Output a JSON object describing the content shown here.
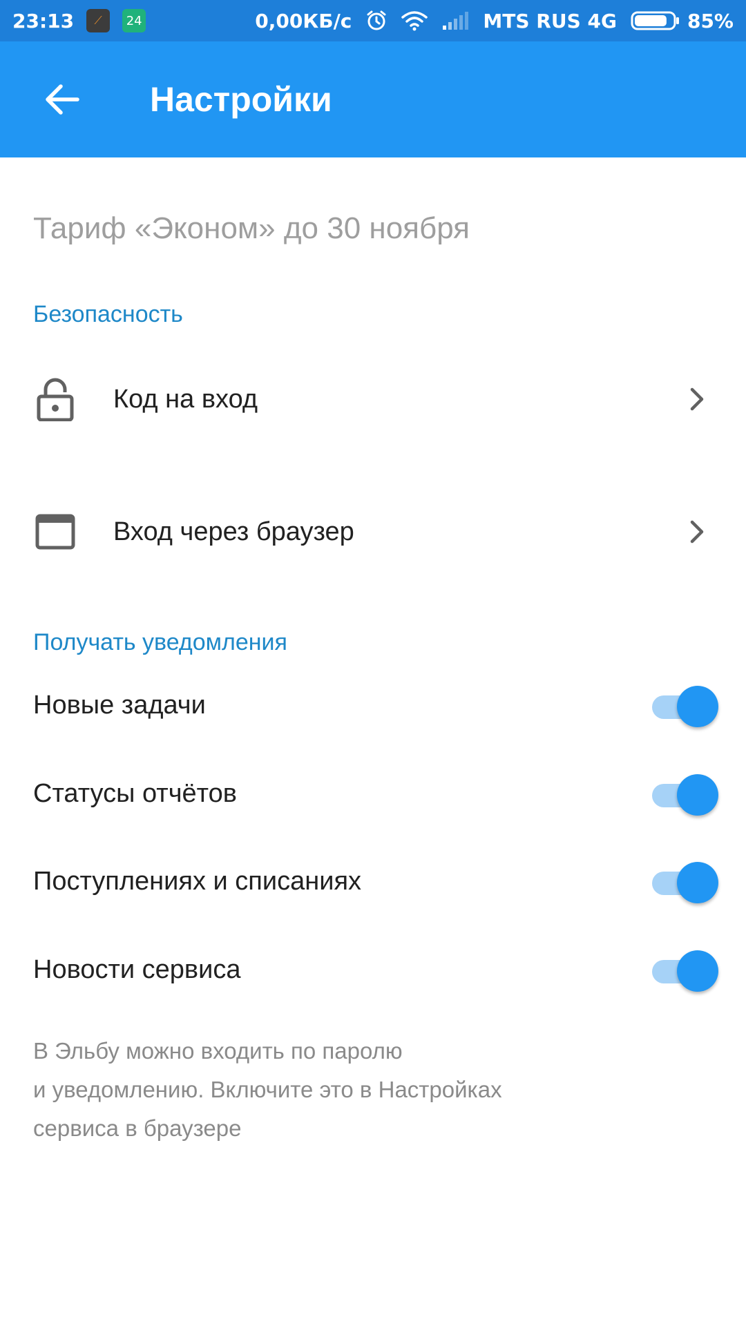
{
  "status_bar": {
    "time": "23:13",
    "notification_badge": "24",
    "network_speed": "0,00КБ/с",
    "carrier": "MTS RUS 4G",
    "battery_percent": "85%",
    "battery_level": 0.85,
    "icons": [
      "alarm-icon",
      "wifi-icon",
      "signal-icon",
      "battery-icon"
    ]
  },
  "app_bar": {
    "title": "Настройки",
    "back_icon": "arrow-left-icon",
    "color": "#2196f3"
  },
  "tariff_text": "Тариф «Эконом» до 30 ноября",
  "security": {
    "header": "Безопасность",
    "items": [
      {
        "label": "Код на вход",
        "icon": "lock-icon"
      },
      {
        "label": "Вход через браузер",
        "icon": "browser-window-icon"
      }
    ]
  },
  "notifications": {
    "header": "Получать уведомления",
    "items": [
      {
        "label": "Новые задачи",
        "enabled": true
      },
      {
        "label": "Статусы отчётов",
        "enabled": true
      },
      {
        "label": "Поступлениях и списаниях",
        "enabled": true
      },
      {
        "label": "Новости сервиса",
        "enabled": true
      }
    ]
  },
  "footnote": {
    "lines": [
      "В Эльбу можно входить по паролю",
      "и уведомлению. Включите это в Настройках",
      "сервиса в браузере"
    ]
  },
  "colors": {
    "status_bar": "#1e7fd9",
    "accent": "#2196f3",
    "section_header": "#1e88c8",
    "switch_track": "#a6d2f7"
  }
}
